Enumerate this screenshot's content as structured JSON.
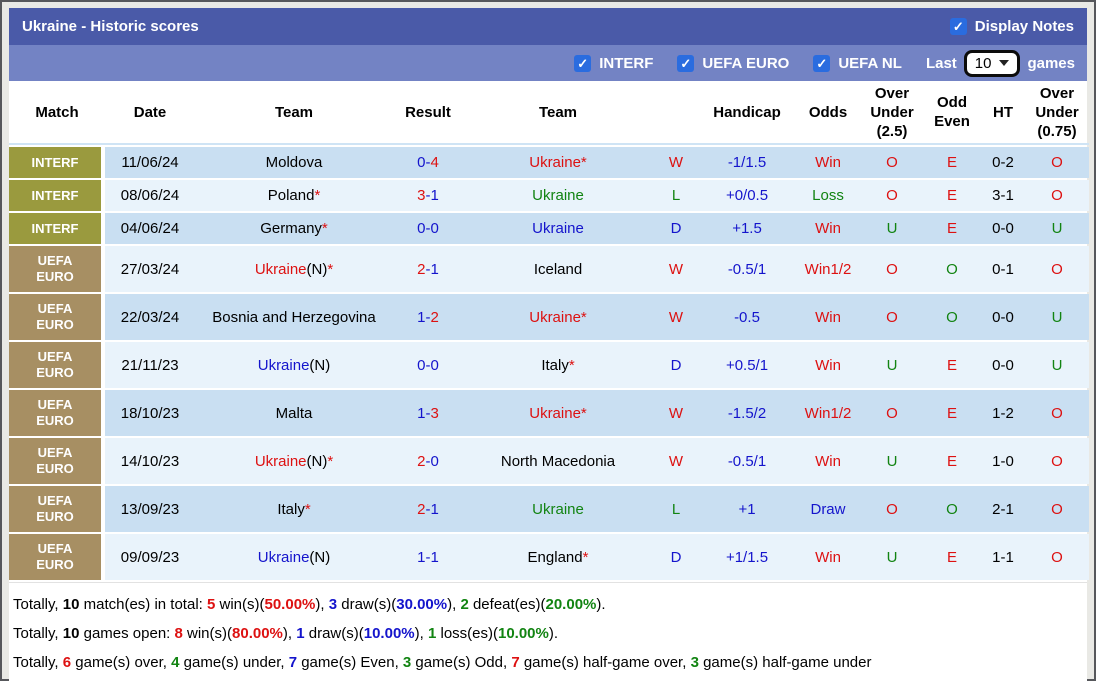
{
  "colors": {
    "red": "#dd1111",
    "blue": "#1414cc",
    "green": "#128412",
    "black": "#000000",
    "interf_bg": "#9a9a3e",
    "euro_bg": "#a78f63",
    "bar_top": "#4a5aa8",
    "bar_filter": "#7383c4",
    "checkbox_blue": "#2a6cdf",
    "row_dark": "#c9dff2",
    "row_light": "#e9f3fb"
  },
  "header": {
    "title": "Ukraine - Historic scores",
    "display_notes_label": "Display Notes",
    "display_notes_checked": true
  },
  "filter_bar": {
    "competitions": [
      {
        "label": "INTERF",
        "checked": true
      },
      {
        "label": "UEFA EURO",
        "checked": true
      },
      {
        "label": "UEFA NL",
        "checked": true
      }
    ],
    "last_label": "Last",
    "last_value": "10",
    "games_label": "games"
  },
  "table": {
    "columns": [
      "Match",
      "Date",
      "Team",
      "Result",
      "Team",
      "",
      "Handicap",
      "Odds",
      "Over\nUnder\n(2.5)",
      "Odd\nEven",
      "HT",
      "Over\nUnder\n(0.75)"
    ],
    "rows": [
      {
        "match": "INTERF",
        "match_bg": "interf_bg",
        "tall": false,
        "date": "11/06/24",
        "home": {
          "name": "Moldova",
          "color": "black",
          "note": "",
          "star": false
        },
        "score": {
          "h": "0",
          "hc": "blue",
          "a": "4",
          "ac": "red"
        },
        "away": {
          "name": "Ukraine",
          "color": "red",
          "note": "",
          "star": true
        },
        "wld": {
          "t": "W",
          "c": "red"
        },
        "handicap": "-1/1.5",
        "odds": {
          "t": "Win",
          "c": "red"
        },
        "ou25": {
          "t": "O",
          "c": "red"
        },
        "oddeven": {
          "t": "E",
          "c": "red"
        },
        "ht": "0-2",
        "ou075": {
          "t": "O",
          "c": "red"
        }
      },
      {
        "match": "INTERF",
        "match_bg": "interf_bg",
        "tall": false,
        "date": "08/06/24",
        "home": {
          "name": "Poland",
          "color": "black",
          "note": "",
          "star": true
        },
        "score": {
          "h": "3",
          "hc": "red",
          "a": "1",
          "ac": "blue"
        },
        "away": {
          "name": "Ukraine",
          "color": "green",
          "note": "",
          "star": false
        },
        "wld": {
          "t": "L",
          "c": "green"
        },
        "handicap": "+0/0.5",
        "odds": {
          "t": "Loss",
          "c": "green"
        },
        "ou25": {
          "t": "O",
          "c": "red"
        },
        "oddeven": {
          "t": "E",
          "c": "red"
        },
        "ht": "3-1",
        "ou075": {
          "t": "O",
          "c": "red"
        }
      },
      {
        "match": "INTERF",
        "match_bg": "interf_bg",
        "tall": false,
        "date": "04/06/24",
        "home": {
          "name": "Germany",
          "color": "black",
          "note": "",
          "star": true
        },
        "score": {
          "h": "0",
          "hc": "blue",
          "a": "0",
          "ac": "blue"
        },
        "away": {
          "name": "Ukraine",
          "color": "blue",
          "note": "",
          "star": false
        },
        "wld": {
          "t": "D",
          "c": "blue"
        },
        "handicap": "+1.5",
        "odds": {
          "t": "Win",
          "c": "red"
        },
        "ou25": {
          "t": "U",
          "c": "green"
        },
        "oddeven": {
          "t": "E",
          "c": "red"
        },
        "ht": "0-0",
        "ou075": {
          "t": "U",
          "c": "green"
        }
      },
      {
        "match": "UEFA\nEURO",
        "match_bg": "euro_bg",
        "tall": true,
        "date": "27/03/24",
        "home": {
          "name": "Ukraine",
          "color": "red",
          "note": "(N)",
          "star": true
        },
        "score": {
          "h": "2",
          "hc": "red",
          "a": "1",
          "ac": "blue"
        },
        "away": {
          "name": "Iceland",
          "color": "black",
          "note": "",
          "star": false
        },
        "wld": {
          "t": "W",
          "c": "red"
        },
        "handicap": "-0.5/1",
        "odds": {
          "t": "Win1/2",
          "c": "red"
        },
        "ou25": {
          "t": "O",
          "c": "red"
        },
        "oddeven": {
          "t": "O",
          "c": "green"
        },
        "ht": "0-1",
        "ou075": {
          "t": "O",
          "c": "red"
        }
      },
      {
        "match": "UEFA\nEURO",
        "match_bg": "euro_bg",
        "tall": true,
        "date": "22/03/24",
        "home": {
          "name": "Bosnia and Herzegovina",
          "color": "black",
          "note": "",
          "star": false
        },
        "score": {
          "h": "1",
          "hc": "blue",
          "a": "2",
          "ac": "red"
        },
        "away": {
          "name": "Ukraine",
          "color": "red",
          "note": "",
          "star": true
        },
        "wld": {
          "t": "W",
          "c": "red"
        },
        "handicap": "-0.5",
        "odds": {
          "t": "Win",
          "c": "red"
        },
        "ou25": {
          "t": "O",
          "c": "red"
        },
        "oddeven": {
          "t": "O",
          "c": "green"
        },
        "ht": "0-0",
        "ou075": {
          "t": "U",
          "c": "green"
        }
      },
      {
        "match": "UEFA\nEURO",
        "match_bg": "euro_bg",
        "tall": true,
        "date": "21/11/23",
        "home": {
          "name": "Ukraine",
          "color": "blue",
          "note": "(N)",
          "star": false
        },
        "score": {
          "h": "0",
          "hc": "blue",
          "a": "0",
          "ac": "blue"
        },
        "away": {
          "name": "Italy",
          "color": "black",
          "note": "",
          "star": true
        },
        "wld": {
          "t": "D",
          "c": "blue"
        },
        "handicap": "+0.5/1",
        "odds": {
          "t": "Win",
          "c": "red"
        },
        "ou25": {
          "t": "U",
          "c": "green"
        },
        "oddeven": {
          "t": "E",
          "c": "red"
        },
        "ht": "0-0",
        "ou075": {
          "t": "U",
          "c": "green"
        }
      },
      {
        "match": "UEFA\nEURO",
        "match_bg": "euro_bg",
        "tall": true,
        "date": "18/10/23",
        "home": {
          "name": "Malta",
          "color": "black",
          "note": "",
          "star": false
        },
        "score": {
          "h": "1",
          "hc": "blue",
          "a": "3",
          "ac": "red"
        },
        "away": {
          "name": "Ukraine",
          "color": "red",
          "note": "",
          "star": true
        },
        "wld": {
          "t": "W",
          "c": "red"
        },
        "handicap": "-1.5/2",
        "odds": {
          "t": "Win1/2",
          "c": "red"
        },
        "ou25": {
          "t": "O",
          "c": "red"
        },
        "oddeven": {
          "t": "E",
          "c": "red"
        },
        "ht": "1-2",
        "ou075": {
          "t": "O",
          "c": "red"
        }
      },
      {
        "match": "UEFA\nEURO",
        "match_bg": "euro_bg",
        "tall": true,
        "date": "14/10/23",
        "home": {
          "name": "Ukraine",
          "color": "red",
          "note": "(N)",
          "star": true
        },
        "score": {
          "h": "2",
          "hc": "red",
          "a": "0",
          "ac": "blue"
        },
        "away": {
          "name": "North Macedonia",
          "color": "black",
          "note": "",
          "star": false
        },
        "wld": {
          "t": "W",
          "c": "red"
        },
        "handicap": "-0.5/1",
        "odds": {
          "t": "Win",
          "c": "red"
        },
        "ou25": {
          "t": "U",
          "c": "green"
        },
        "oddeven": {
          "t": "E",
          "c": "red"
        },
        "ht": "1-0",
        "ou075": {
          "t": "O",
          "c": "red"
        }
      },
      {
        "match": "UEFA\nEURO",
        "match_bg": "euro_bg",
        "tall": true,
        "date": "13/09/23",
        "home": {
          "name": "Italy",
          "color": "black",
          "note": "",
          "star": true
        },
        "score": {
          "h": "2",
          "hc": "red",
          "a": "1",
          "ac": "blue"
        },
        "away": {
          "name": "Ukraine",
          "color": "green",
          "note": "",
          "star": false
        },
        "wld": {
          "t": "L",
          "c": "green"
        },
        "handicap": "+1",
        "odds": {
          "t": "Draw",
          "c": "blue"
        },
        "ou25": {
          "t": "O",
          "c": "red"
        },
        "oddeven": {
          "t": "O",
          "c": "green"
        },
        "ht": "2-1",
        "ou075": {
          "t": "O",
          "c": "red"
        }
      },
      {
        "match": "UEFA\nEURO",
        "match_bg": "euro_bg",
        "tall": true,
        "date": "09/09/23",
        "home": {
          "name": "Ukraine",
          "color": "blue",
          "note": "(N)",
          "star": false
        },
        "score": {
          "h": "1",
          "hc": "blue",
          "a": "1",
          "ac": "blue"
        },
        "away": {
          "name": "England",
          "color": "black",
          "note": "",
          "star": true
        },
        "wld": {
          "t": "D",
          "c": "blue"
        },
        "handicap": "+1/1.5",
        "odds": {
          "t": "Win",
          "c": "red"
        },
        "ou25": {
          "t": "U",
          "c": "green"
        },
        "oddeven": {
          "t": "E",
          "c": "red"
        },
        "ht": "1-1",
        "ou075": {
          "t": "O",
          "c": "red"
        }
      }
    ]
  },
  "footer": {
    "lines": [
      {
        "segments": [
          {
            "t": "Totally, "
          },
          {
            "t": "10",
            "c": "black",
            "b": 1
          },
          {
            "t": " match(es) in total: "
          },
          {
            "t": "5",
            "c": "red",
            "b": 1
          },
          {
            "t": " win(s)("
          },
          {
            "t": "50.00%",
            "c": "red",
            "b": 1
          },
          {
            "t": "), "
          },
          {
            "t": "3",
            "c": "blue",
            "b": 1
          },
          {
            "t": " draw(s)("
          },
          {
            "t": "30.00%",
            "c": "blue",
            "b": 1
          },
          {
            "t": "), "
          },
          {
            "t": "2",
            "c": "green",
            "b": 1
          },
          {
            "t": " defeat(es)("
          },
          {
            "t": "20.00%",
            "c": "green",
            "b": 1
          },
          {
            "t": ")."
          }
        ]
      },
      {
        "segments": [
          {
            "t": "Totally, "
          },
          {
            "t": "10",
            "c": "black",
            "b": 1
          },
          {
            "t": " games open: "
          },
          {
            "t": "8",
            "c": "red",
            "b": 1
          },
          {
            "t": " win(s)("
          },
          {
            "t": "80.00%",
            "c": "red",
            "b": 1
          },
          {
            "t": "), "
          },
          {
            "t": "1",
            "c": "blue",
            "b": 1
          },
          {
            "t": " draw(s)("
          },
          {
            "t": "10.00%",
            "c": "blue",
            "b": 1
          },
          {
            "t": "), "
          },
          {
            "t": "1",
            "c": "green",
            "b": 1
          },
          {
            "t": " loss(es)("
          },
          {
            "t": "10.00%",
            "c": "green",
            "b": 1
          },
          {
            "t": ")."
          }
        ]
      },
      {
        "segments": [
          {
            "t": "Totally, "
          },
          {
            "t": "6",
            "c": "red",
            "b": 1
          },
          {
            "t": " game(s) over, "
          },
          {
            "t": "4",
            "c": "green",
            "b": 1
          },
          {
            "t": " game(s) under, "
          },
          {
            "t": "7",
            "c": "blue",
            "b": 1
          },
          {
            "t": " game(s) Even, "
          },
          {
            "t": "3",
            "c": "green",
            "b": 1
          },
          {
            "t": " game(s) Odd, "
          },
          {
            "t": "7",
            "c": "red",
            "b": 1
          },
          {
            "t": " game(s) half-game over, "
          },
          {
            "t": "3",
            "c": "green",
            "b": 1
          },
          {
            "t": " game(s) half-game under"
          }
        ]
      }
    ]
  }
}
